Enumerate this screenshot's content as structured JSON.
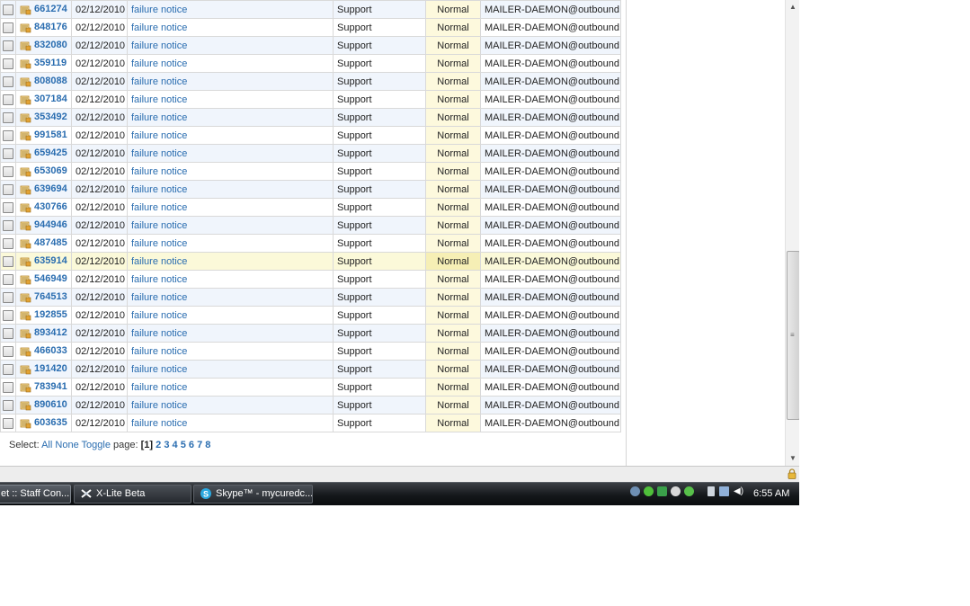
{
  "tickets": [
    {
      "id": "661274",
      "date": "02/12/2010",
      "subject": "failure notice",
      "department": "Support",
      "priority": "Normal",
      "from": "MAILER-DAEMON@outbound"
    },
    {
      "id": "848176",
      "date": "02/12/2010",
      "subject": "failure notice",
      "department": "Support",
      "priority": "Normal",
      "from": "MAILER-DAEMON@outbound"
    },
    {
      "id": "832080",
      "date": "02/12/2010",
      "subject": "failure notice",
      "department": "Support",
      "priority": "Normal",
      "from": "MAILER-DAEMON@outbound"
    },
    {
      "id": "359119",
      "date": "02/12/2010",
      "subject": "failure notice",
      "department": "Support",
      "priority": "Normal",
      "from": "MAILER-DAEMON@outbound"
    },
    {
      "id": "808088",
      "date": "02/12/2010",
      "subject": "failure notice",
      "department": "Support",
      "priority": "Normal",
      "from": "MAILER-DAEMON@outbound"
    },
    {
      "id": "307184",
      "date": "02/12/2010",
      "subject": "failure notice",
      "department": "Support",
      "priority": "Normal",
      "from": "MAILER-DAEMON@outbound"
    },
    {
      "id": "353492",
      "date": "02/12/2010",
      "subject": "failure notice",
      "department": "Support",
      "priority": "Normal",
      "from": "MAILER-DAEMON@outbound"
    },
    {
      "id": "991581",
      "date": "02/12/2010",
      "subject": "failure notice",
      "department": "Support",
      "priority": "Normal",
      "from": "MAILER-DAEMON@outbound"
    },
    {
      "id": "659425",
      "date": "02/12/2010",
      "subject": "failure notice",
      "department": "Support",
      "priority": "Normal",
      "from": "MAILER-DAEMON@outbound"
    },
    {
      "id": "653069",
      "date": "02/12/2010",
      "subject": "failure notice",
      "department": "Support",
      "priority": "Normal",
      "from": "MAILER-DAEMON@outbound"
    },
    {
      "id": "639694",
      "date": "02/12/2010",
      "subject": "failure notice",
      "department": "Support",
      "priority": "Normal",
      "from": "MAILER-DAEMON@outbound"
    },
    {
      "id": "430766",
      "date": "02/12/2010",
      "subject": "failure notice",
      "department": "Support",
      "priority": "Normal",
      "from": "MAILER-DAEMON@outbound"
    },
    {
      "id": "944946",
      "date": "02/12/2010",
      "subject": "failure notice",
      "department": "Support",
      "priority": "Normal",
      "from": "MAILER-DAEMON@outbound"
    },
    {
      "id": "487485",
      "date": "02/12/2010",
      "subject": "failure notice",
      "department": "Support",
      "priority": "Normal",
      "from": "MAILER-DAEMON@outbound"
    },
    {
      "id": "635914",
      "date": "02/12/2010",
      "subject": "failure notice",
      "department": "Support",
      "priority": "Normal",
      "from": "MAILER-DAEMON@outbound",
      "highlighted": true
    },
    {
      "id": "546949",
      "date": "02/12/2010",
      "subject": "failure notice",
      "department": "Support",
      "priority": "Normal",
      "from": "MAILER-DAEMON@outbound"
    },
    {
      "id": "764513",
      "date": "02/12/2010",
      "subject": "failure notice",
      "department": "Support",
      "priority": "Normal",
      "from": "MAILER-DAEMON@outbound"
    },
    {
      "id": "192855",
      "date": "02/12/2010",
      "subject": "failure notice",
      "department": "Support",
      "priority": "Normal",
      "from": "MAILER-DAEMON@outbound"
    },
    {
      "id": "893412",
      "date": "02/12/2010",
      "subject": "failure notice",
      "department": "Support",
      "priority": "Normal",
      "from": "MAILER-DAEMON@outbound"
    },
    {
      "id": "466033",
      "date": "02/12/2010",
      "subject": "failure notice",
      "department": "Support",
      "priority": "Normal",
      "from": "MAILER-DAEMON@outbound"
    },
    {
      "id": "191420",
      "date": "02/12/2010",
      "subject": "failure notice",
      "department": "Support",
      "priority": "Normal",
      "from": "MAILER-DAEMON@outbound"
    },
    {
      "id": "783941",
      "date": "02/12/2010",
      "subject": "failure notice",
      "department": "Support",
      "priority": "Normal",
      "from": "MAILER-DAEMON@outbound"
    },
    {
      "id": "890610",
      "date": "02/12/2010",
      "subject": "failure notice",
      "department": "Support",
      "priority": "Normal",
      "from": "MAILER-DAEMON@outbound"
    },
    {
      "id": "603635",
      "date": "02/12/2010",
      "subject": "failure notice",
      "department": "Support",
      "priority": "Normal",
      "from": "MAILER-DAEMON@outbound"
    }
  ],
  "select_bar": {
    "select_label": "Select:",
    "all": "All",
    "none": "None",
    "toggle": "Toggle",
    "page_label": "page:",
    "current_page": "[1]",
    "pages": [
      "2",
      "3",
      "4",
      "5",
      "6",
      "7",
      "8"
    ]
  },
  "taskbar": {
    "buttons": [
      {
        "label": "et :: Staff Con...",
        "icon": "browser-icon",
        "active": true
      },
      {
        "label": "X-Lite Beta",
        "icon": "x-lite-icon"
      },
      {
        "label": "Skype™ - mycuredc...",
        "icon": "skype-icon"
      }
    ],
    "tray_icons": [
      "network-icon",
      "status-green-icon",
      "arrows-icon",
      "stop-icon",
      "messenger-icon",
      "device-icon",
      "display-icon",
      "volume-icon"
    ],
    "clock": "6:55 AM"
  },
  "colors": {
    "link": "#2a6db0",
    "row_alt": "#f0f5fc",
    "row_highlight": "#fbf9d9",
    "priority_cell": "#fdf9dd"
  }
}
